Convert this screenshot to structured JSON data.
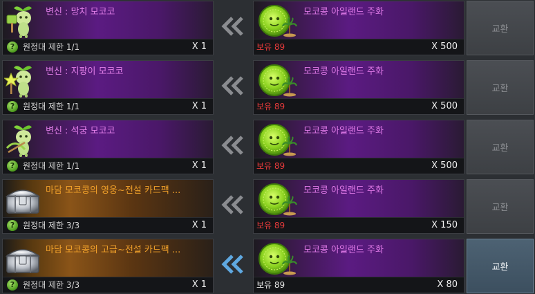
{
  "rows": [
    {
      "item_name": "변신 : 망치 모코코",
      "item_kind": "sprout-hammer",
      "limit": "원정대 제한 1/1",
      "item_qty": "X 1",
      "currency_name": "모코콩 아일랜드 주화",
      "owned": "보유 89",
      "cost": "X 500",
      "button": "교환",
      "affordable": false
    },
    {
      "item_name": "변신 : 지팡이 모코코",
      "item_kind": "sprout-staff",
      "limit": "원정대 제한 1/1",
      "item_qty": "X 1",
      "currency_name": "모코콩 아일랜드 주화",
      "owned": "보유 89",
      "cost": "X 500",
      "button": "교환",
      "affordable": false
    },
    {
      "item_name": "변신 : 석궁 모코코",
      "item_kind": "sprout-crossbow",
      "limit": "원정대 제한 1/1",
      "item_qty": "X 1",
      "currency_name": "모코콩 아일랜드 주화",
      "owned": "보유 89",
      "cost": "X 500",
      "button": "교환",
      "affordable": false
    },
    {
      "item_name": "마담 모코콩의 영웅~전설 카드팩 ...",
      "item_kind": "chest",
      "limit": "원정대 제한 3/3",
      "item_qty": "X 1",
      "currency_name": "모코콩 아일랜드 주화",
      "owned": "보유 89",
      "cost": "X 150",
      "button": "교환",
      "affordable": false
    },
    {
      "item_name": "마담 모코콩의 고급~전설 카드팩 ...",
      "item_kind": "chest",
      "limit": "원정대 제한 3/3",
      "item_qty": "X 1",
      "currency_name": "모코콩 아일랜드 주화",
      "owned": "보유 89",
      "cost": "X 80",
      "button": "교환",
      "affordable": true
    }
  ],
  "colors": {
    "purple_title": "#e27fe9",
    "gold_title": "#f0a02a",
    "insufficient": "#e63a3a",
    "arrow_active": "#5fa8e0",
    "arrow_inactive": "#8a8c90"
  },
  "icons": {
    "help": "question-mark",
    "exchange_arrow": "double-chevron-left"
  }
}
